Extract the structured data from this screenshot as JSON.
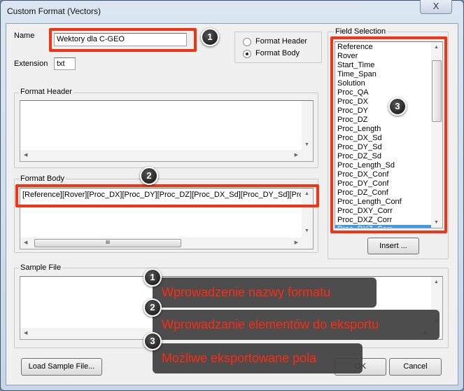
{
  "window": {
    "title": "Custom Format (Vectors)",
    "close_label": "X"
  },
  "name": {
    "label": "Name",
    "value": "Wektory dla C-GEO"
  },
  "extension": {
    "label": "Extension",
    "value": "txt"
  },
  "radio": {
    "options": [
      {
        "label": "Format Header",
        "checked": false
      },
      {
        "label": "Format Body",
        "checked": true
      }
    ]
  },
  "format_header": {
    "label": "Format Header",
    "value": ""
  },
  "format_body": {
    "label": "Format Body",
    "value": "[Reference][Rover][Proc_DX][Proc_DY][Proc_DZ][Proc_DX_Sd][Proc_DY_Sd][Proc"
  },
  "field_selection": {
    "label": "Field Selection",
    "items": [
      "Reference",
      "Rover",
      "Start_Time",
      "Time_Span",
      "Solution",
      "Proc_QA",
      "Proc_DX",
      "Proc_DY",
      "Proc_DZ",
      "Proc_Length",
      "Proc_DX_Sd",
      "Proc_DY_Sd",
      "Proc_DZ_Sd",
      "Proc_Length_Sd",
      "Proc_DX_Conf",
      "Proc_DY_Conf",
      "Proc_DZ_Conf",
      "Proc_Length_Conf",
      "Proc_DXY_Corr",
      "Proc_DXZ_Corr",
      "Proc_DYZ_Corr"
    ],
    "insert_label": "Insert ..."
  },
  "sample_file": {
    "label": "Sample File"
  },
  "buttons": {
    "load": "Load Sample File...",
    "ok": "OK",
    "cancel": "Cancel"
  },
  "annotations": {
    "badges": [
      "1",
      "2",
      "3"
    ],
    "tips": [
      "Wprowadzenie nazwy formatu",
      "Wprowadzanie elementów do eksportu",
      "Możliwe eksportowane pola"
    ],
    "highlight_color": "#f03414"
  }
}
